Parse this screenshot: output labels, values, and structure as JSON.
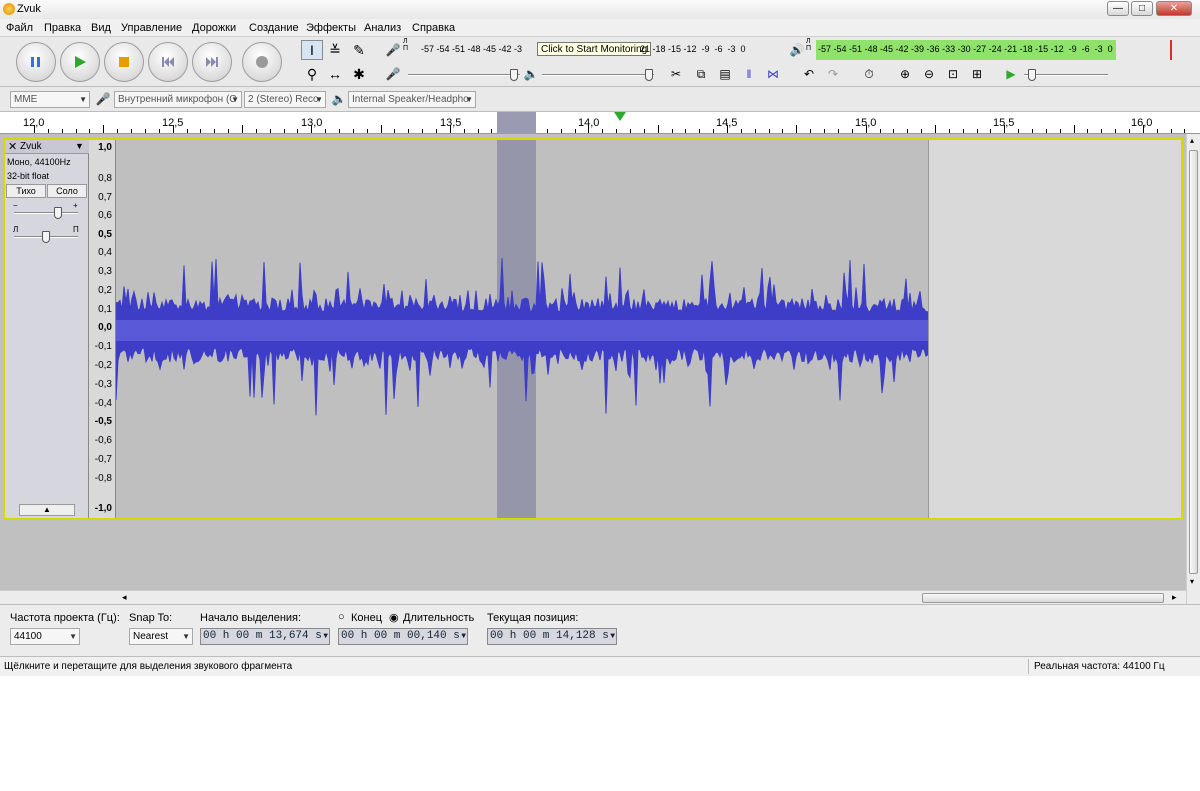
{
  "window": {
    "title": "Zvuk",
    "minimize": "—",
    "maximize": "□",
    "close": "✕"
  },
  "menu": [
    "Файл",
    "Правка",
    "Вид",
    "Управление",
    "Дорожки",
    "Создание",
    "Эффекты",
    "Анализ",
    "Справка"
  ],
  "meters": {
    "record_channel": "Л\nП",
    "record_scale": "-57 -54 -51 -48 -45 -42 -3",
    "record_tooltip": "Click to Start Monitoring",
    "record_scale_tail": "21 -18 -15 -12  -9  -6  -3  0",
    "play_channel": "Л\nП",
    "play_scale": "-57 -54 -51 -48 -45 -42 -39 -36 -33 -30 -27 -24 -21 -18 -15 -12  -9  -6  -3  0"
  },
  "devices": {
    "host": "MME",
    "input": "Внутренний микрофон (С",
    "channels": "2 (Stereo) Reco",
    "output": "Internal Speaker/Headpho"
  },
  "ruler": [
    "12,0",
    "12,5",
    "13,0",
    "13,5",
    "14,0",
    "14,5",
    "15,0",
    "15,5",
    "16,0"
  ],
  "track": {
    "name": "Zvuk",
    "info1": "Моно, 44100Hz",
    "info2": "32-bit float",
    "mute": "Тихо",
    "solo": "Соло",
    "gain_minus": "−",
    "gain_plus": "+",
    "pan_l": "Л",
    "pan_r": "П",
    "collapse": "▲"
  },
  "vruler": [
    "1,0",
    "0,8",
    "0,7",
    "0,6",
    "0,5",
    "0,4",
    "0,3",
    "0,2",
    "0,1",
    "0,0",
    "-0,1",
    "-0,2",
    "-0,3",
    "-0,4",
    "-0,5",
    "-0,6",
    "-0,7",
    "-0,8",
    "-1,0"
  ],
  "selection": {
    "rate_label": "Частота проекта (Гц):",
    "rate_value": "44100",
    "snap_label": "Snap To:",
    "snap_value": "Nearest",
    "start_label": "Начало выделения:",
    "end_option": "Конец",
    "length_option": "Длительность",
    "start_value": "00 h 00 m 13,674 s",
    "length_value": "00 h 00 m 00,140 s",
    "position_label": "Текущая позиция:",
    "position_value": "00 h 00 m 14,128 s"
  },
  "status": {
    "hint": "Щёлкните и перетащите для выделения звукового фрагмента",
    "rate": "Реальная частота: 44100 Гц"
  },
  "colors": {
    "waveform": "#3d3dc8",
    "selection": "#8e8ea6",
    "meter_green": "#8fe36a"
  }
}
